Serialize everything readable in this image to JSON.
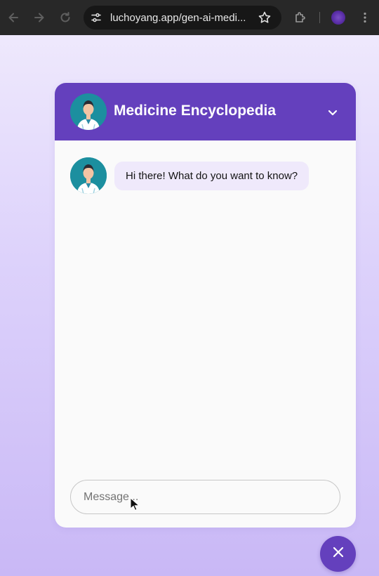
{
  "browser": {
    "url": "luchoyang.app/gen-ai-medi...",
    "icons": [
      "back-icon",
      "forward-icon",
      "reload-icon",
      "site-settings-icon",
      "bookmark-star-icon",
      "extensions-icon",
      "profile-icon",
      "menu-icon"
    ]
  },
  "chat": {
    "title": "Medicine Encyclopedia",
    "messages": [
      {
        "sender": "bot",
        "text": "Hi there! What do you want to know?"
      }
    ],
    "input": {
      "placeholder": "Message...",
      "value": ""
    },
    "icons": [
      "doctor-avatar-icon",
      "chevron-down-icon",
      "close-icon"
    ]
  },
  "colors": {
    "accent": "#6440bd",
    "bubble": "#efe9fb",
    "panel": "#fafafa",
    "browser_bar": "#282828"
  }
}
